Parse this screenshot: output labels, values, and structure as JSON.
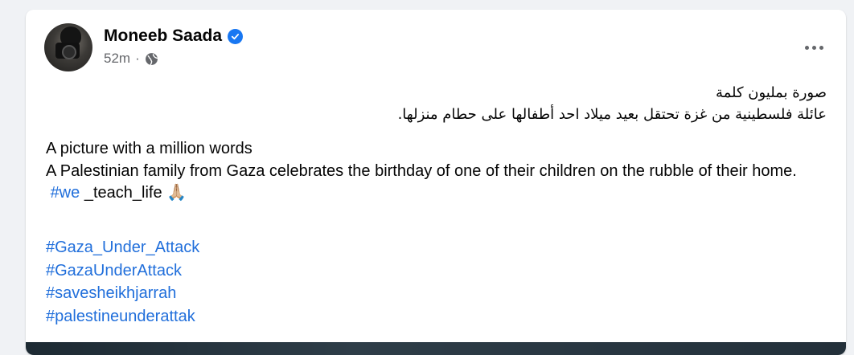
{
  "post": {
    "author": "Moneeb Saada",
    "verified": true,
    "timestamp": "52m",
    "separator": "·",
    "audience_icon": "globe-icon",
    "more_icon": "more-options-icon",
    "arabic_line1": "صورة بمليون كلمة",
    "arabic_line2": "عائلة فلسطينية من غزة تحتقل بعيد ميلاد احد أطفالها على حطام منزلها.",
    "english_line1": "A picture with a million words",
    "english_line2": "A Palestinian family from Gaza celebrates the birthday of one of their children on the rubble of their home.",
    "hashtag_we": "#we",
    "teach_life_text": " _teach_life 🙏🏼",
    "hashtags": [
      "#Gaza_Under_Attack",
      "#GazaUnderAttack",
      "#savesheikhjarrah",
      "#palestineunderattak"
    ]
  },
  "colors": {
    "link": "#216fdb",
    "verified": "#1877f2",
    "meta": "#65676b",
    "background": "#f0f2f5"
  }
}
